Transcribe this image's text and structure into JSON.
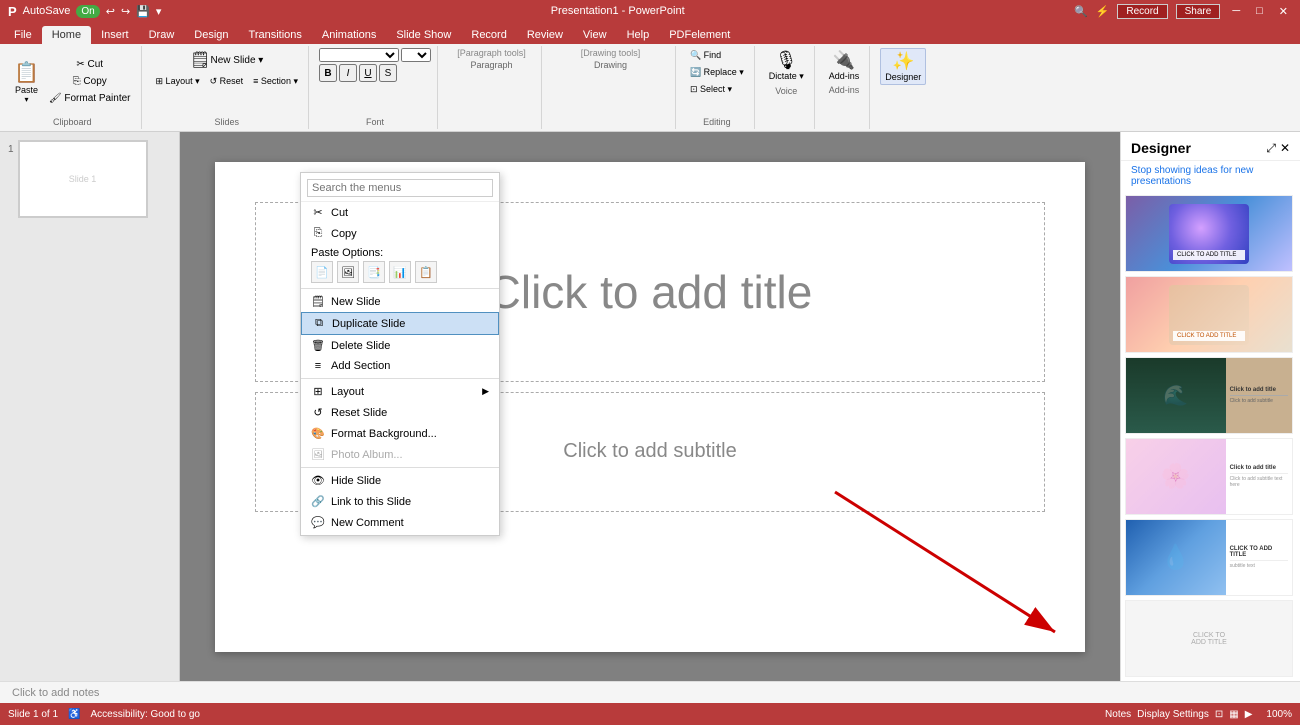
{
  "titlebar": {
    "autosave_label": "AutoSave",
    "autosave_state": "On",
    "title": "Presentation1 - PowerPoint",
    "search_placeholder": "Search",
    "record_btn": "Record",
    "share_btn": "Share",
    "minimize": "─",
    "restore": "□",
    "close": "✕"
  },
  "ribbon_tabs": [
    "File",
    "Home",
    "Insert",
    "Draw",
    "Design",
    "Transitions",
    "Animations",
    "Slide Show",
    "Record",
    "Review",
    "View",
    "Help",
    "PDFelement"
  ],
  "active_tab": "Home",
  "ribbon_groups": {
    "clipboard": {
      "label": "Clipboard",
      "buttons": [
        "Paste",
        "Cut",
        "Copy",
        "Format Painter"
      ]
    },
    "slides": {
      "label": "Slides"
    },
    "font": {
      "label": "Font"
    },
    "paragraph": {
      "label": "Paragraph"
    },
    "drawing": {
      "label": "Drawing"
    },
    "editing": {
      "label": "Editing"
    },
    "voice": {
      "label": "Voice"
    },
    "addins": {
      "label": "Add-ins"
    }
  },
  "slide": {
    "number": "1",
    "title_placeholder": "Click to add title",
    "subtitle_placeholder": "Click to add subtitle",
    "notes_placeholder": "Click to add notes"
  },
  "context_menu": {
    "search_placeholder": "Search the menus",
    "items": [
      {
        "id": "cut",
        "label": "Cut",
        "icon": "✂",
        "shortcut": ""
      },
      {
        "id": "copy",
        "label": "Copy",
        "icon": "⎘",
        "shortcut": ""
      },
      {
        "id": "paste_options",
        "label": "Paste Options:",
        "type": "paste-header"
      },
      {
        "id": "new_slide",
        "label": "New Slide",
        "icon": "□",
        "shortcut": ""
      },
      {
        "id": "duplicate_slide",
        "label": "Duplicate Slide",
        "icon": "⧉",
        "shortcut": "",
        "highlighted": true
      },
      {
        "id": "delete_slide",
        "label": "Delete Slide",
        "icon": "🗑",
        "shortcut": ""
      },
      {
        "id": "add_section",
        "label": "Add Section",
        "icon": "≡",
        "shortcut": ""
      },
      {
        "id": "layout",
        "label": "Layout",
        "icon": "⊞",
        "shortcut": "",
        "hasArrow": true
      },
      {
        "id": "reset_slide",
        "label": "Reset Slide",
        "icon": "↺",
        "shortcut": ""
      },
      {
        "id": "format_background",
        "label": "Format Background...",
        "icon": "🎨",
        "shortcut": ""
      },
      {
        "id": "photo_album",
        "label": "Photo Album...",
        "icon": "🖼",
        "shortcut": "",
        "disabled": true
      },
      {
        "id": "hide_slide",
        "label": "Hide Slide",
        "icon": "👁",
        "shortcut": ""
      },
      {
        "id": "link_to_slide",
        "label": "Link to this Slide",
        "icon": "🔗",
        "shortcut": ""
      },
      {
        "id": "new_comment",
        "label": "New Comment",
        "icon": "💬",
        "shortcut": ""
      }
    ]
  },
  "designer": {
    "title": "Designer",
    "link": "Stop showing ideas for new presentations",
    "close_icon": "✕",
    "expand_icon": "⤢",
    "templates": [
      {
        "id": 1,
        "style": "tmpl-1",
        "has_inner": false
      },
      {
        "id": 2,
        "style": "tmpl-2",
        "has_inner": true,
        "inner_title": "CLICK TO ADD TITLE"
      },
      {
        "id": 3,
        "style": "tmpl-3",
        "has_inner": true,
        "inner_title": "Click to add title"
      },
      {
        "id": 4,
        "style": "tmpl-4",
        "has_inner": true,
        "inner_title": "Click to add title"
      },
      {
        "id": 5,
        "style": "tmpl-5",
        "has_inner": true,
        "inner_title": "CLICK TO ADD TITLE"
      },
      {
        "id": 6,
        "style": "tmpl-6",
        "has_inner": false
      }
    ]
  },
  "status_bar": {
    "slide_info": "Slide 1 of 1",
    "accessibility": "Accessibility: Good to go",
    "notes_label": "Notes",
    "display_settings": "Display Settings",
    "zoom": "100%"
  }
}
